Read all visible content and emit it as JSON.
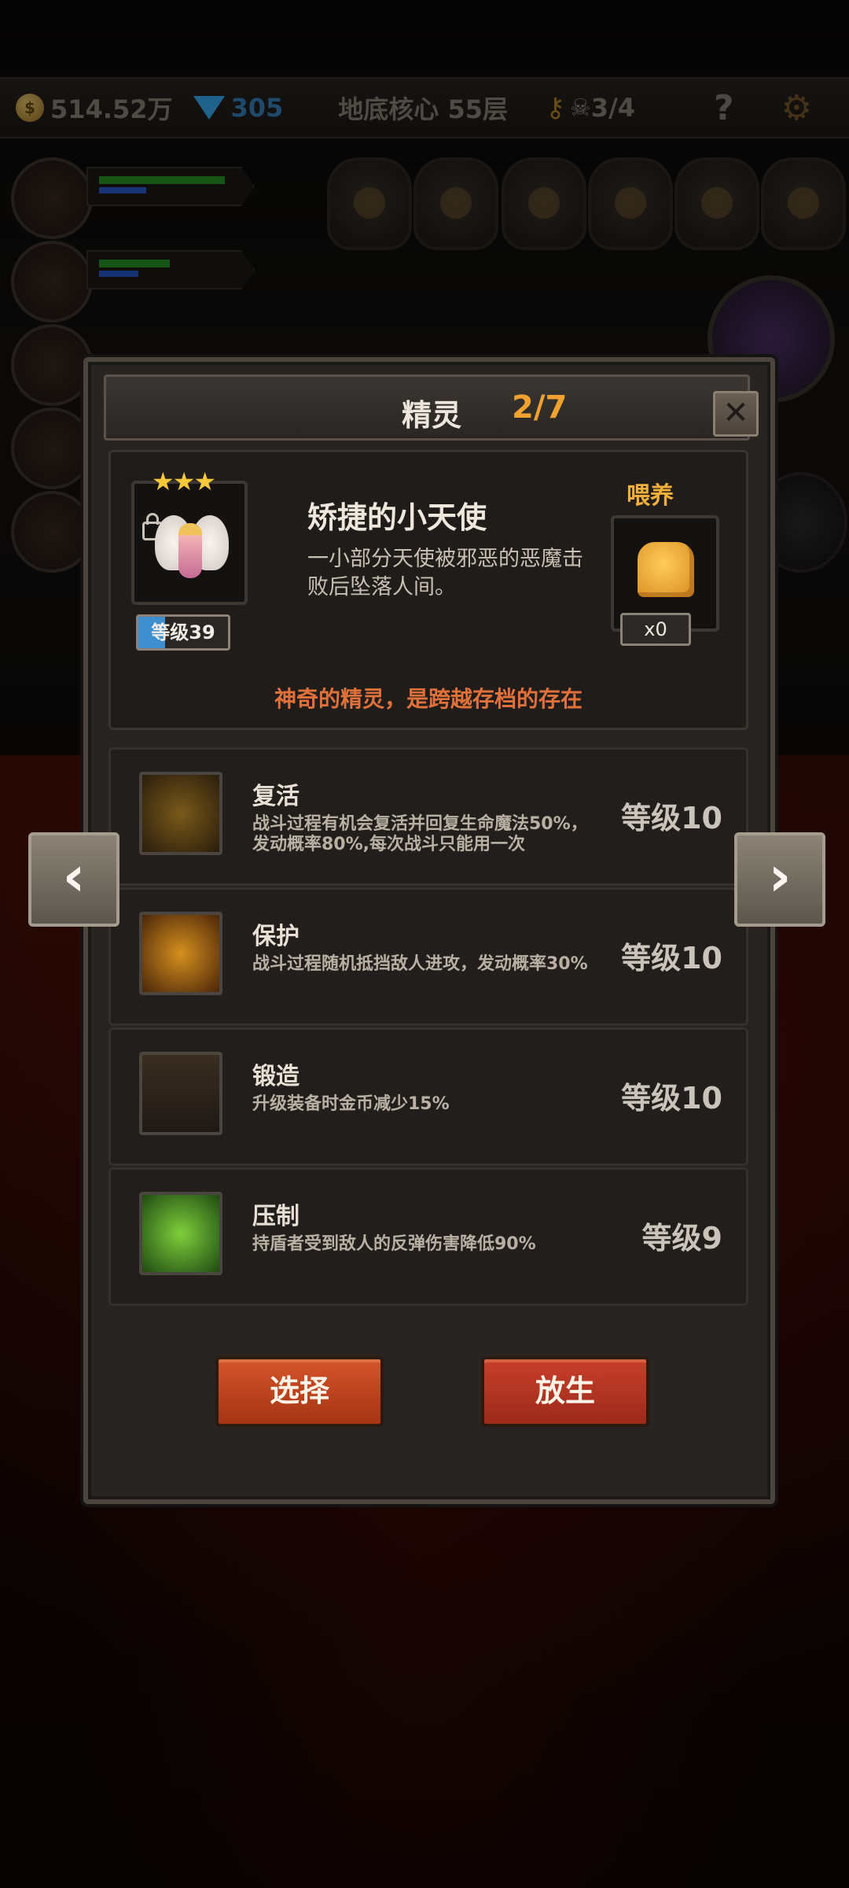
{
  "hud": {
    "gold": "514.52万",
    "gems": "305",
    "floor": "地底核心 55层",
    "skulls": "3/4",
    "help": "?",
    "settings_icon": "gear-icon"
  },
  "dialog": {
    "title": "精灵",
    "count": "2/7",
    "close": "✕",
    "sprite": {
      "name": "矫捷的小天使",
      "stars": "★★★",
      "level": "等级39",
      "level_progress": 0.3,
      "description": "一小部分天使被邪恶的恶魔击败后坠落人间。",
      "feed_label": "喂养",
      "feed_count": "x0",
      "motto": "神奇的精灵，是跨越存档的存在"
    },
    "skills": [
      {
        "name": "复活",
        "desc": "战斗过程有机会复活并回复生命魔法50%，发动概率80%,每次战斗只能用一次",
        "level": "等级10"
      },
      {
        "name": "保护",
        "desc": "战斗过程随机抵挡敌人进攻，发动概率30%",
        "level": "等级10"
      },
      {
        "name": "锻造",
        "desc": "升级装备时金币减少15%",
        "level": "等级10"
      },
      {
        "name": "压制",
        "desc": "持盾者受到敌人的反弹伤害降低90%",
        "level": "等级9"
      }
    ],
    "buttons": {
      "select": "选择",
      "release": "放生"
    }
  },
  "nav": {
    "prev": "‹",
    "next": "›"
  },
  "colors": {
    "accent_orange": "#f0a230",
    "motto": "#e0713a",
    "button_red": "#c93f2b"
  }
}
